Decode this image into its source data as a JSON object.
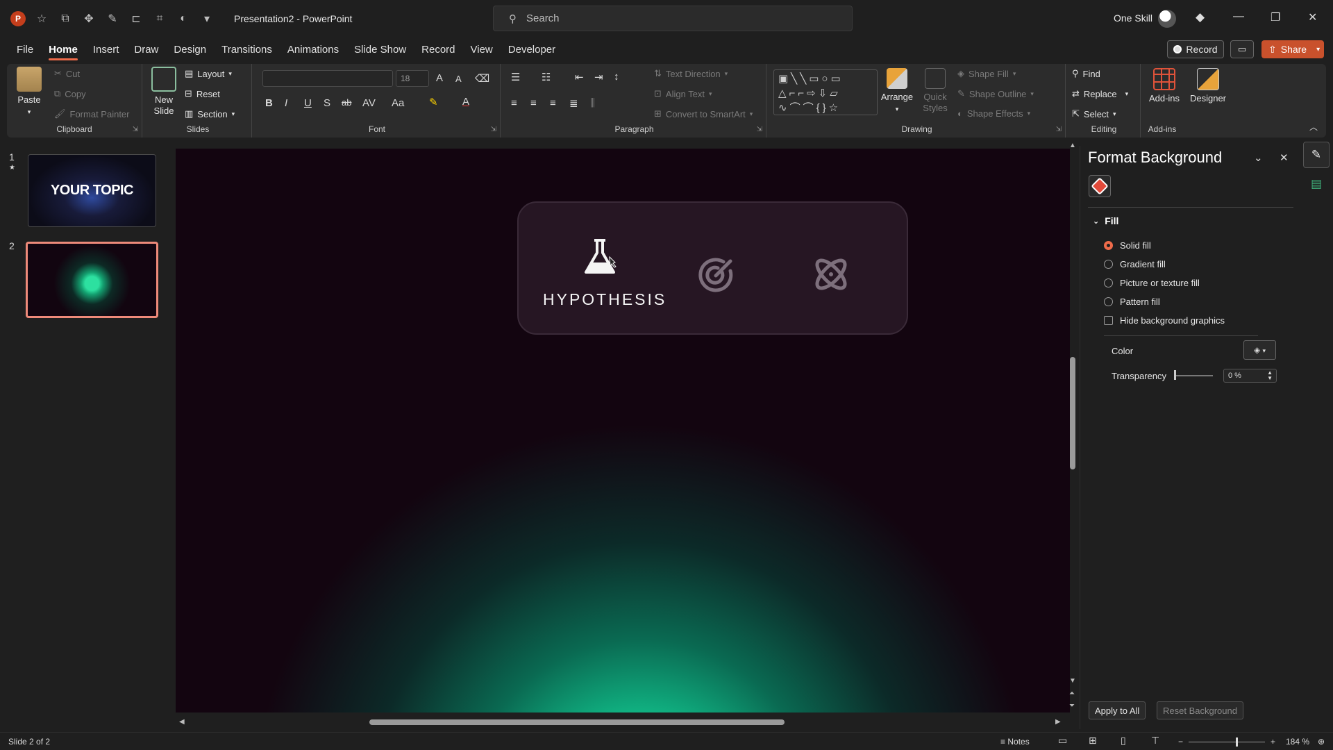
{
  "titlebar": {
    "app_letter": "P",
    "doc_title": "Presentation2  -  PowerPoint",
    "search_placeholder": "Search",
    "user_name": "One Skill",
    "minimize": "—",
    "restore": "❐",
    "close": "✕"
  },
  "tabs": [
    "File",
    "Home",
    "Insert",
    "Draw",
    "Design",
    "Transitions",
    "Animations",
    "Slide Show",
    "Record",
    "View",
    "Developer"
  ],
  "active_tab": "Home",
  "topright": {
    "record": "Record",
    "share": "Share"
  },
  "ribbon": {
    "clipboard": {
      "label": "Clipboard",
      "paste": "Paste",
      "cut": "Cut",
      "copy": "Copy",
      "format_painter": "Format Painter"
    },
    "slides": {
      "label": "Slides",
      "new_slide_1": "New",
      "new_slide_2": "Slide",
      "layout": "Layout",
      "reset": "Reset",
      "section": "Section"
    },
    "font": {
      "label": "Font",
      "size": "18",
      "bold": "B",
      "italic": "I",
      "underline": "U",
      "shadow": "S",
      "strike": "ab",
      "spacing": "AV",
      "case": "Aa",
      "grow": "A",
      "shrink": "A",
      "color": "A"
    },
    "paragraph": {
      "label": "Paragraph",
      "text_direction": "Text Direction",
      "align_text": "Align Text",
      "smartart": "Convert to SmartArt"
    },
    "drawing": {
      "label": "Drawing",
      "arrange": "Arrange",
      "quick_styles_1": "Quick",
      "quick_styles_2": "Styles",
      "shape_fill": "Shape Fill",
      "shape_outline": "Shape Outline",
      "shape_effects": "Shape Effects"
    },
    "editing": {
      "label": "Editing",
      "find": "Find",
      "replace": "Replace",
      "select": "Select"
    },
    "addins": {
      "label": "Add-ins",
      "addins_btn": "Add-ins",
      "designer": "Designer"
    }
  },
  "slides_panel": {
    "slide1_number": "1",
    "slide1_title": "YOUR TOPIC",
    "slide2_number": "2"
  },
  "slide": {
    "icon_label": "HYPOTHESIS"
  },
  "format_pane": {
    "title": "Format Background",
    "section": "Fill",
    "options": [
      "Solid fill",
      "Gradient fill",
      "Picture or texture fill",
      "Pattern fill"
    ],
    "selected_option": "Solid fill",
    "hide_graphics": "Hide background graphics",
    "color_label": "Color",
    "transparency_label": "Transparency",
    "transparency_value": "0 %",
    "apply_all": "Apply to All",
    "reset_bg": "Reset Background"
  },
  "statusbar": {
    "slide_info": "Slide 2 of 2",
    "notes": "Notes",
    "zoom": "184 %"
  },
  "colors": {
    "accent": "#ee6b4a",
    "share": "#c9512c",
    "slide_bg": "#130510",
    "glow": "#1de8a8"
  }
}
